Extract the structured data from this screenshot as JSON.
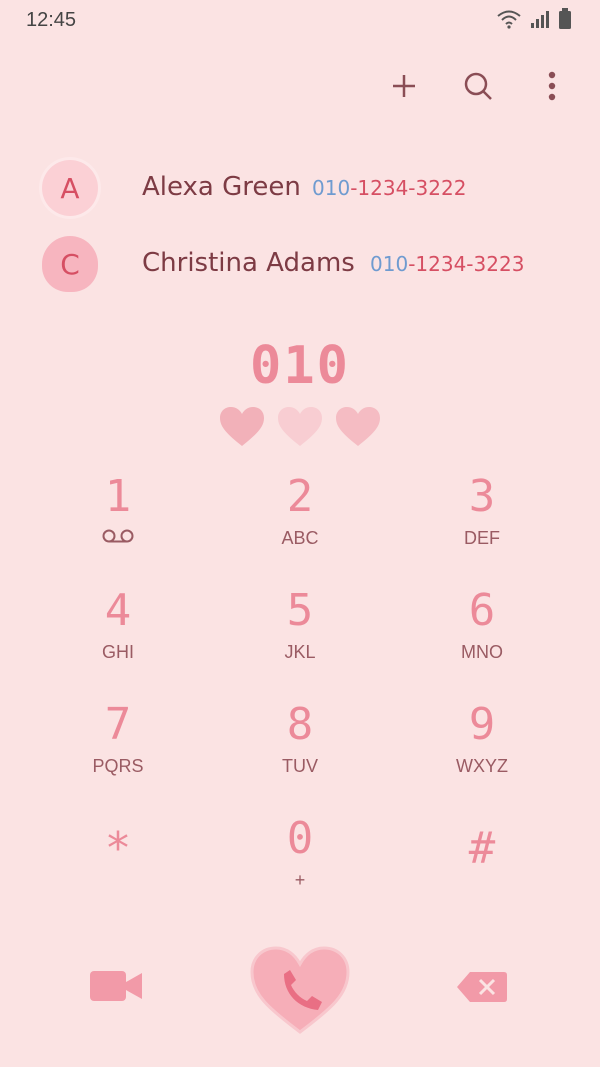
{
  "status": {
    "time": "12:45"
  },
  "contacts": [
    {
      "initial": "A",
      "name": "Alexa Green",
      "number_prefix": "010",
      "number_rest": "-1234-3222"
    },
    {
      "initial": "C",
      "name": "Christina Adams",
      "number_prefix": "010",
      "number_rest": "-1234-3223"
    }
  ],
  "dialed_number": "010",
  "keys": [
    {
      "digit": "1",
      "letters": ""
    },
    {
      "digit": "2",
      "letters": "ABC"
    },
    {
      "digit": "3",
      "letters": "DEF"
    },
    {
      "digit": "4",
      "letters": "GHI"
    },
    {
      "digit": "5",
      "letters": "JKL"
    },
    {
      "digit": "6",
      "letters": "MNO"
    },
    {
      "digit": "7",
      "letters": "PQRS"
    },
    {
      "digit": "8",
      "letters": "TUV"
    },
    {
      "digit": "9",
      "letters": "WXYZ"
    },
    {
      "digit": "*",
      "letters": ""
    },
    {
      "digit": "0",
      "letters": "+"
    },
    {
      "digit": "#",
      "letters": ""
    }
  ],
  "icons": {
    "add": "plus-icon",
    "search": "search-icon",
    "more": "more-vertical-icon",
    "voicemail": "voicemail-icon",
    "video": "video-call-icon",
    "call": "phone-icon",
    "backspace": "backspace-icon"
  },
  "colors": {
    "accent": "#ec8a99",
    "background": "#fbe3e3",
    "text": "#7d3b44",
    "prefix": "#6f9bd0"
  }
}
